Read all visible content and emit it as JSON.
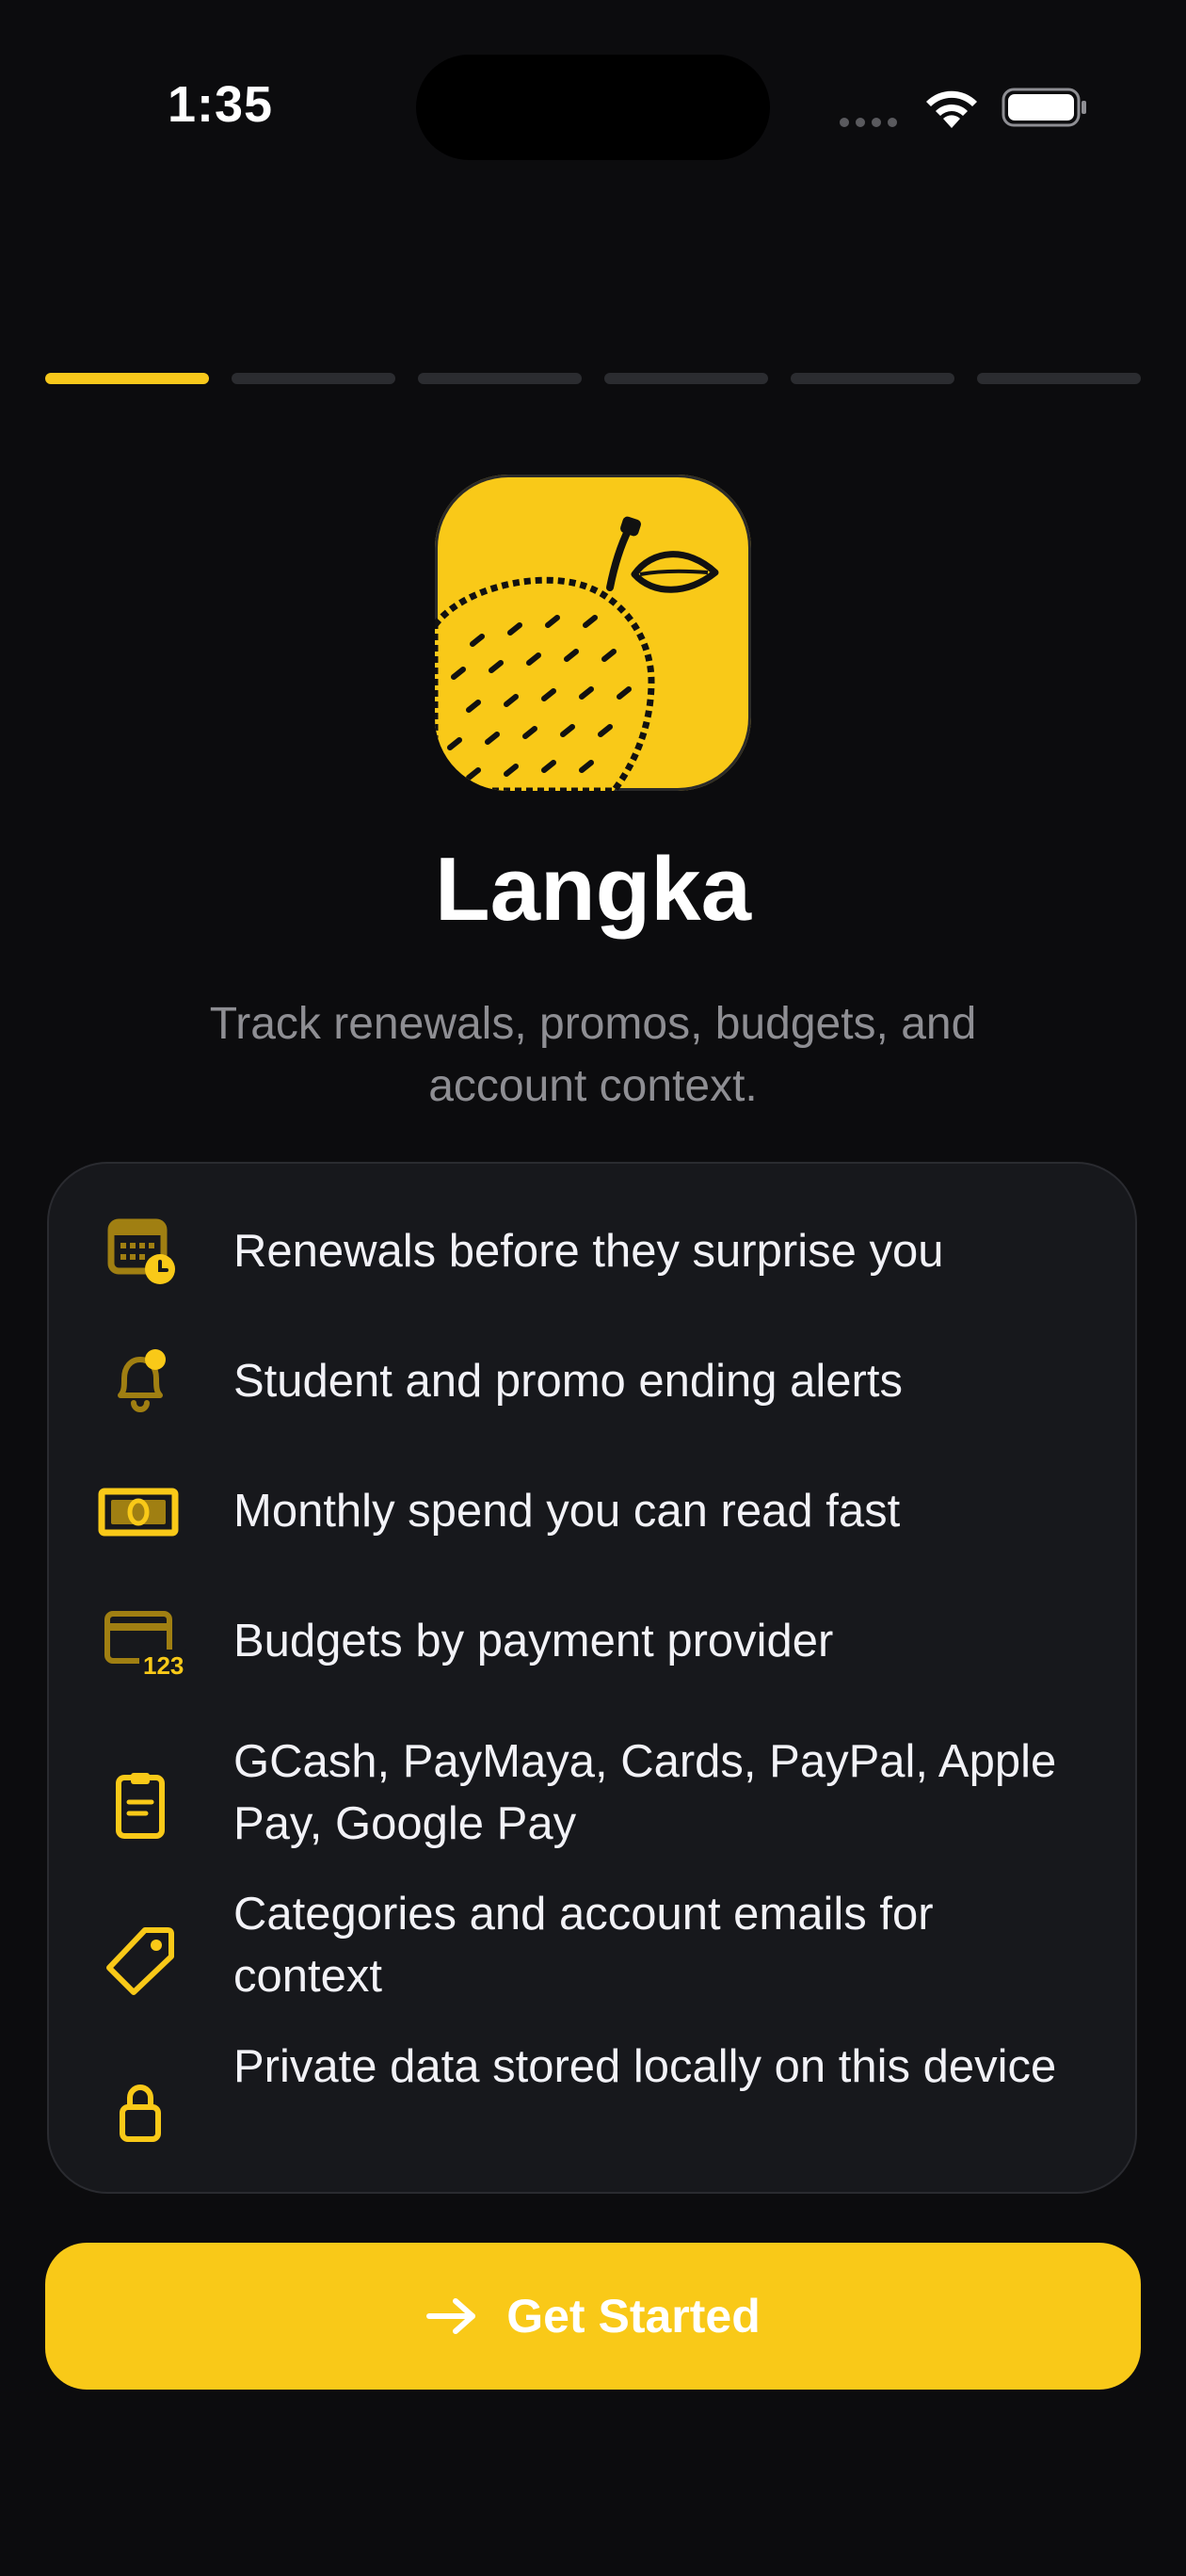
{
  "status_bar": {
    "time": "1:35"
  },
  "onboarding": {
    "steps_total": 6,
    "current_step": 1
  },
  "app": {
    "name": "Langka",
    "tagline": "Track renewals, promos, budgets, and account context.",
    "accent_color": "#f9c918"
  },
  "features": [
    {
      "icon": "calendar-clock-icon",
      "text": "Renewals before they surprise you"
    },
    {
      "icon": "bell-badge-icon",
      "text": "Student and promo ending alerts"
    },
    {
      "icon": "banknote-icon",
      "text": "Monthly spend you can read fast"
    },
    {
      "icon": "creditcard-123-icon",
      "text": "Budgets by payment provider"
    },
    {
      "icon": "clipboard-icon",
      "text": "GCash, PayMaya, Cards, PayPal, Apple Pay, Google Pay"
    },
    {
      "icon": "tag-icon",
      "text": "Categories and account emails for context"
    },
    {
      "icon": "lock-icon",
      "text": "Private data stored locally on this device"
    }
  ],
  "cta": {
    "label": "Get Started",
    "icon": "arrow-right-icon"
  }
}
